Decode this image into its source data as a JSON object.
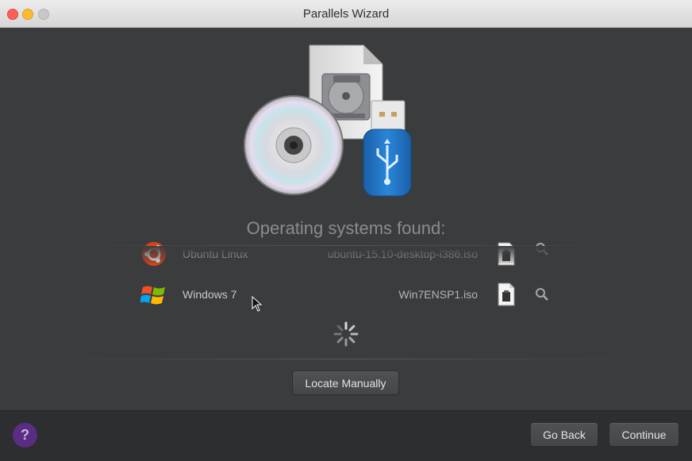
{
  "window": {
    "title": "Parallels Wizard"
  },
  "main": {
    "heading": "Operating systems found:",
    "os_list": [
      {
        "name": "Ubuntu Linux",
        "file": "ubuntu-15.10-desktop-i386.iso",
        "icon": "ubuntu-logo-icon"
      },
      {
        "name": "Windows 7",
        "file": "Win7ENSP1.iso",
        "icon": "windows-logo-icon"
      }
    ],
    "locate_button": "Locate Manually"
  },
  "footer": {
    "help_label": "?",
    "back_button": "Go Back",
    "continue_button": "Continue"
  },
  "colors": {
    "help_purple": "#5b2c84",
    "usb_blue": "#1a6fc4",
    "ubuntu_orange": "#d7431c"
  }
}
